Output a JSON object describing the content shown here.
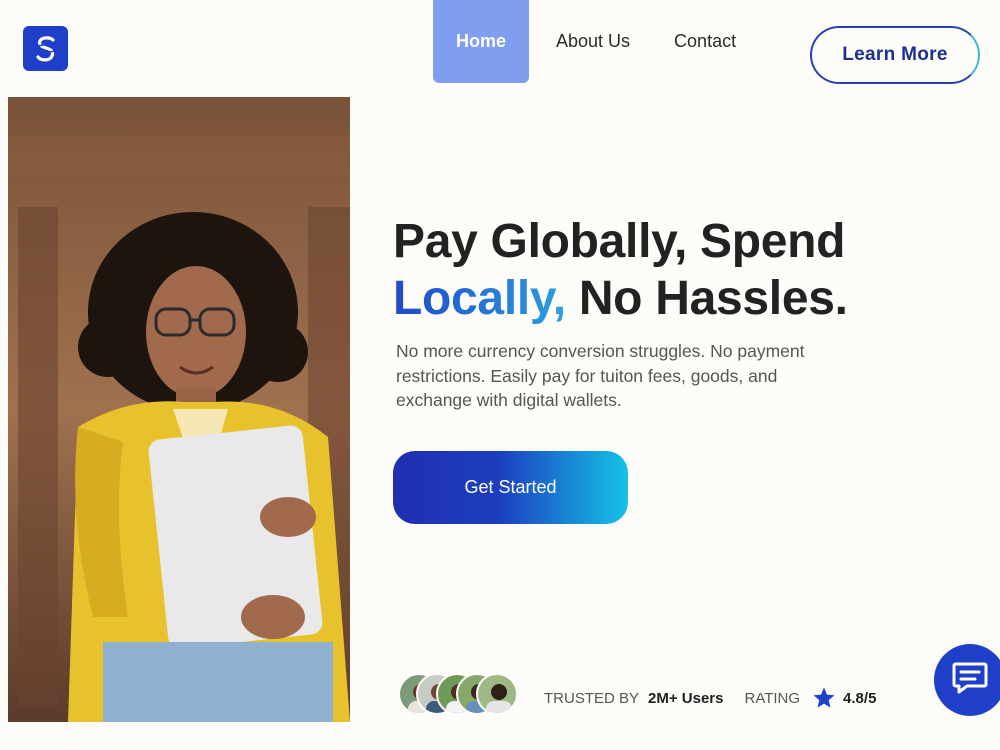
{
  "header": {
    "logo_icon": "s-logo-icon",
    "nav": [
      {
        "label": "Home",
        "active": true
      },
      {
        "label": "About Us",
        "active": false
      },
      {
        "label": "Contact",
        "active": false
      }
    ],
    "learn_more_label": "Learn More"
  },
  "hero": {
    "headline_line1": "Pay Globally, Spend",
    "headline_accent": "Locally,",
    "headline_rest": " No Hassles.",
    "subtext": "No more currency conversion struggles. No payment restrictions. Easily pay for tuiton fees, goods, and exchange with digital wallets.",
    "cta_label": "Get Started",
    "image": "student-holding-laptop-photo"
  },
  "trust": {
    "trusted_by_label": "TRUSTED BY",
    "users_count": "2M+ Users",
    "rating_label": "RATING",
    "rating_value": "4.8/5",
    "rating_icon": "star-icon"
  },
  "chat": {
    "icon": "chat-icon"
  },
  "colors": {
    "brand": "#1f3fc9",
    "nav_active_bg": "#7f9ef0",
    "accent_gradient_start": "#1f47c9",
    "accent_gradient_end": "#2aa0e0",
    "cta_gradient_start": "#1f2fb0",
    "cta_gradient_end": "#16c2e6",
    "background": "#fdfcf8"
  }
}
